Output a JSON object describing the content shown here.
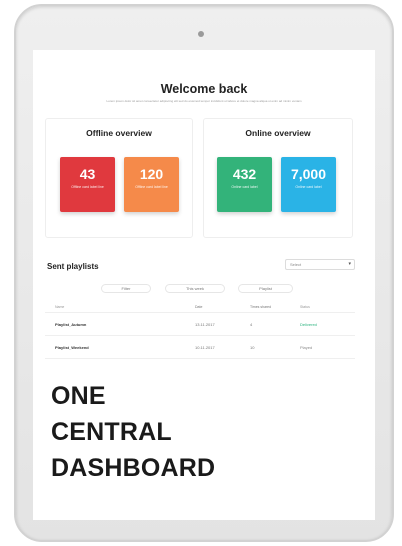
{
  "welcome": {
    "title": "Welcome back",
    "subtitle": "Lorem ipsum dolor sit amet consectetur adipiscing elit sed do eiusmod tempor incididunt ut labore et dolore magna aliqua ut enim ad minim veniam"
  },
  "offline": {
    "title": "Offline overview",
    "cards": [
      {
        "value": "43",
        "label": "Offline card label line",
        "color": "#e0393e"
      },
      {
        "value": "120",
        "label": "Offline card label line",
        "color": "#f58a4a"
      }
    ]
  },
  "online": {
    "title": "Online overview",
    "cards": [
      {
        "value": "432",
        "label": "Online card label",
        "color": "#33b37a"
      },
      {
        "value": "7,000",
        "label": "Online card label",
        "color": "#2ab3e6"
      }
    ]
  },
  "sent": {
    "title": "Sent playlists",
    "select_value": "Select",
    "chips": [
      "Filter",
      "This week",
      "Playlist"
    ],
    "columns": [
      "Name",
      "Date",
      "Times shared",
      "Status"
    ],
    "rows": [
      {
        "name": "Playlist_Autumn",
        "date": "13.11.2017",
        "shared": "4",
        "status": "Delivered",
        "status_color": "#2bb37f"
      },
      {
        "name": "Playlist_Weekend",
        "date": "10.11.2017",
        "shared": "10",
        "status": "Played",
        "status_color": "#8a8a8a"
      }
    ]
  },
  "headline": [
    "ONE",
    "CENTRAL",
    "DASHBOARD"
  ]
}
